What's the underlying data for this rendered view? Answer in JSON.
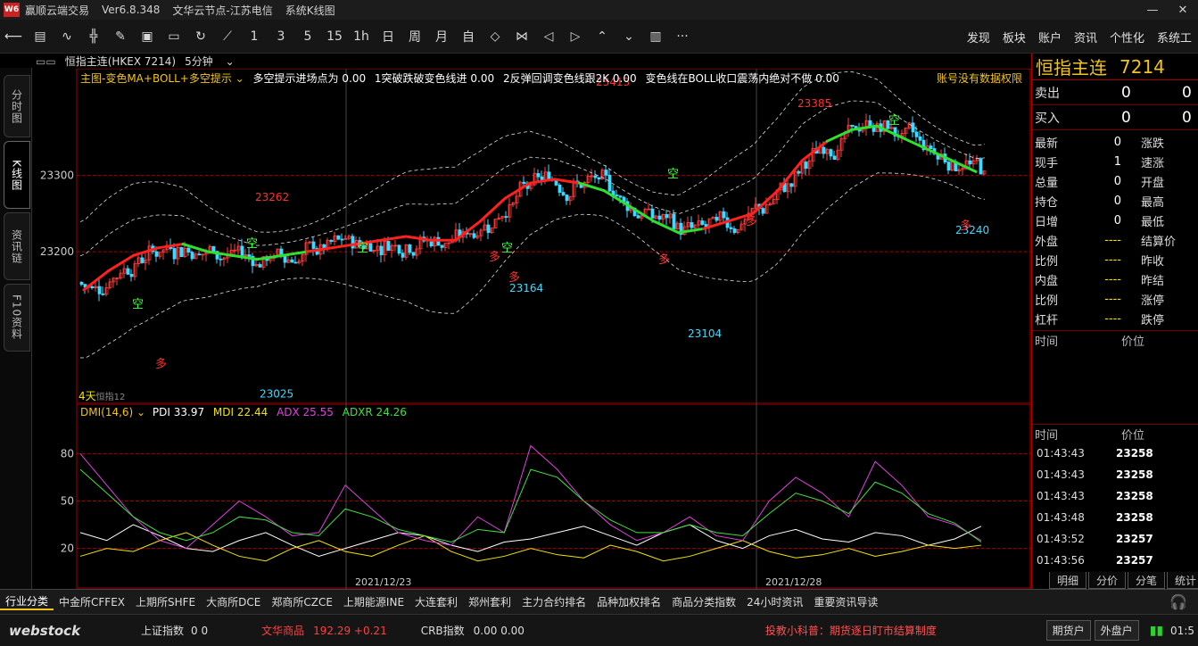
{
  "titlebar": {
    "app_name": "赢顺云端交易",
    "version": "Ver6.8.348",
    "node": "文华云节点-江苏电信",
    "mode": "系统K线图"
  },
  "toolbar": {
    "periods": [
      "1",
      "3",
      "5",
      "15",
      "1h",
      "日",
      "周",
      "月",
      "自"
    ],
    "more": "···",
    "right_menu": [
      "发现",
      "板块",
      "账户",
      "资讯",
      "个性化",
      "系统工"
    ]
  },
  "side_tabs": [
    "分时图",
    "K线图",
    "资讯链",
    "F10资料"
  ],
  "chart_header": {
    "symbol": "恒指主连(HKEX 7214)",
    "period": "5分钟"
  },
  "main_indicator": {
    "name": "主图-变色MA+BOLL+多空提示",
    "params": [
      {
        "label": "多空提示进场点为",
        "value": "0.00"
      },
      {
        "label": "1突破跌破变色线进",
        "value": "0.00"
      },
      {
        "label": "2反弹回调变色线跟2K",
        "value": "0.00"
      },
      {
        "label": "变色线在BOLL收口震荡内绝对不做",
        "value": "0.00"
      }
    ],
    "notice": "账号没有数据权限",
    "extra_label": "4天",
    "extra_label2": "恒指12"
  },
  "sub_indicator": {
    "name": "DMI(14,6)",
    "pdi": "PDI 33.97",
    "mdi": "MDI 22.44",
    "adx": "ADX 25.55",
    "adxr": "ADXR 24.26",
    "colors": {
      "pdi": "#ffffff",
      "mdi": "#f3e300",
      "adx": "#e040e0",
      "adxr": "#40e040"
    }
  },
  "chart_data": [
    {
      "type": "line",
      "title": "恒指主连(HKEX 7214) 5分钟",
      "ylim": [
        23000,
        23440
      ],
      "y_ticks": [
        23200,
        23300
      ],
      "x_ticks": [
        "2021/12/23",
        "2021/12/28"
      ],
      "annotations": [
        {
          "text": "23262",
          "kind": "high"
        },
        {
          "text": "23164",
          "kind": "low"
        },
        {
          "text": "23413",
          "kind": "high"
        },
        {
          "text": "23385",
          "kind": "high"
        },
        {
          "text": "23104",
          "kind": "low"
        },
        {
          "text": "23025",
          "kind": "low"
        },
        {
          "text": "23240",
          "kind": "low"
        }
      ],
      "signals": [
        {
          "text": "空",
          "color": "#40ff40"
        },
        {
          "text": "空",
          "color": "#40ff40"
        },
        {
          "text": "空",
          "color": "#40ff40"
        },
        {
          "text": "空",
          "color": "#40ff40"
        },
        {
          "text": "空",
          "color": "#40ff40"
        },
        {
          "text": "空",
          "color": "#40ff40"
        },
        {
          "text": "多",
          "color": "#ff3030"
        },
        {
          "text": "多",
          "color": "#ff3030"
        },
        {
          "text": "多",
          "color": "#ff3030"
        },
        {
          "text": "多",
          "color": "#ff3030"
        },
        {
          "text": "多",
          "color": "#ff3030"
        },
        {
          "text": "多",
          "color": "#ff3030"
        }
      ],
      "ma_line": [
        23150,
        23175,
        23195,
        23205,
        23210,
        23200,
        23195,
        23190,
        23195,
        23200,
        23205,
        23210,
        23215,
        23220,
        23215,
        23215,
        23240,
        23270,
        23290,
        23295,
        23290,
        23280,
        23260,
        23240,
        23225,
        23230,
        23240,
        23250,
        23280,
        23320,
        23345,
        23360,
        23365,
        23350,
        23335,
        23320,
        23305
      ]
    },
    {
      "type": "line",
      "title": "DMI(14,6)",
      "y_ticks": [
        20,
        50,
        80
      ],
      "ylim": [
        0,
        100
      ],
      "series": [
        {
          "name": "PDI",
          "values": [
            30,
            25,
            35,
            28,
            20,
            18,
            25,
            30,
            22,
            15,
            20,
            25,
            30,
            28,
            22,
            18,
            24,
            26,
            30,
            34,
            28,
            22,
            30,
            35,
            25,
            20,
            28,
            32,
            26,
            24,
            30,
            28,
            22,
            26,
            34
          ]
        },
        {
          "name": "MDI",
          "values": [
            15,
            20,
            18,
            25,
            30,
            22,
            15,
            12,
            20,
            25,
            18,
            15,
            22,
            28,
            18,
            12,
            15,
            20,
            16,
            14,
            22,
            18,
            12,
            15,
            20,
            25,
            18,
            14,
            16,
            20,
            15,
            18,
            22,
            20,
            22
          ]
        },
        {
          "name": "ADX",
          "values": [
            80,
            60,
            40,
            25,
            20,
            35,
            50,
            40,
            28,
            30,
            60,
            45,
            30,
            25,
            22,
            40,
            30,
            85,
            70,
            50,
            35,
            25,
            30,
            40,
            28,
            25,
            50,
            65,
            55,
            40,
            75,
            60,
            40,
            35,
            25
          ]
        },
        {
          "name": "ADXR",
          "values": [
            70,
            55,
            40,
            30,
            25,
            30,
            40,
            38,
            30,
            28,
            45,
            40,
            32,
            28,
            24,
            32,
            30,
            70,
            65,
            50,
            38,
            30,
            30,
            35,
            30,
            28,
            42,
            55,
            50,
            42,
            62,
            55,
            42,
            36,
            24
          ]
        }
      ]
    }
  ],
  "right_panel": {
    "title": "恒指主连",
    "code": "7214",
    "sell": {
      "label": "卖出",
      "v1": "0",
      "v2": "0"
    },
    "buy": {
      "label": "买入",
      "v1": "0",
      "v2": "0"
    },
    "quote_rows": [
      {
        "l": "最新",
        "v": "0",
        "l2": "涨跌"
      },
      {
        "l": "现手",
        "v": "1",
        "l2": "速涨"
      },
      {
        "l": "总量",
        "v": "0",
        "l2": "开盘"
      },
      {
        "l": "持仓",
        "v": "0",
        "l2": "最高"
      },
      {
        "l": "日增",
        "v": "0",
        "l2": "最低"
      },
      {
        "l": "外盘",
        "v": "----",
        "l2": "结算价"
      },
      {
        "l": "比例",
        "v": "----",
        "l2": "昨收"
      },
      {
        "l": "内盘",
        "v": "----",
        "l2": "昨结"
      },
      {
        "l": "比例",
        "v": "----",
        "l2": "涨停"
      },
      {
        "l": "杠杆",
        "v": "----",
        "l2": "跌停"
      }
    ],
    "tick_header": {
      "time": "时间",
      "price": "价位"
    },
    "ticks": [
      {
        "t": "01:43:43",
        "p": "23258"
      },
      {
        "t": "01:43:43",
        "p": "23258"
      },
      {
        "t": "01:43:43",
        "p": "23258"
      },
      {
        "t": "01:43:48",
        "p": "23258"
      },
      {
        "t": "01:43:52",
        "p": "23257"
      },
      {
        "t": "01:43:56",
        "p": "23257"
      }
    ],
    "tabs": [
      "明细",
      "分价",
      "分笔",
      "统计"
    ]
  },
  "bottom_tabs": [
    "行业分类",
    "中金所CFFEX",
    "上期所SHFE",
    "大商所DCE",
    "郑商所CZCE",
    "上期能源INE",
    "大连套利",
    "郑州套利",
    "主力合约排名",
    "品种加权排名",
    "商品分类指数",
    "24小时资讯",
    "重要资讯导读"
  ],
  "statusbar": {
    "brand": "webstock",
    "idx1_name": "上证指数",
    "idx1_vals": "0  0",
    "idx2_name": "文华商品",
    "idx2_vals": "192.29  +0.21",
    "idx3_name": "CRB指数",
    "idx3_vals": "0.00  0.00",
    "notice": "投教小科普：期货逐日盯市结算制度",
    "btn1": "期货户",
    "btn2": "外盘户",
    "time": "01:5"
  }
}
